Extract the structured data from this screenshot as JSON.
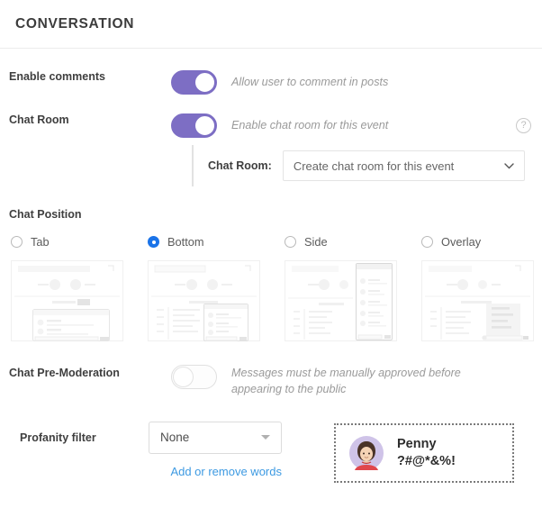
{
  "header": {
    "title": "CONVERSATION"
  },
  "enable_comments": {
    "label": "Enable comments",
    "hint": "Allow user to comment in posts",
    "toggle_state": "on"
  },
  "chat_room": {
    "label": "Chat Room",
    "hint": "Enable chat room for this event",
    "toggle_state": "on",
    "help_icon": "?",
    "sub_label": "Chat Room:",
    "select_value": "Create chat room for this event",
    "chevron": "⌄"
  },
  "chat_position": {
    "label": "Chat Position",
    "options": [
      {
        "label": "Tab",
        "selected": false
      },
      {
        "label": "Bottom",
        "selected": true
      },
      {
        "label": "Side",
        "selected": false
      },
      {
        "label": "Overlay",
        "selected": false
      }
    ]
  },
  "pre_moderation": {
    "label": "Chat Pre-Moderation",
    "hint": "Messages must be manually approved before appearing to the public",
    "toggle_state": "off"
  },
  "profanity": {
    "label": "Profanity filter",
    "select_value": "None",
    "link_label": "Add or remove words",
    "preview": {
      "name": "Penny",
      "message": "?#@*&%!",
      "avatar_bg": "#cfc3e8",
      "avatar_hair": "#4a3328",
      "avatar_shirt": "#e0474c"
    }
  },
  "colors": {
    "toggle_on": "#7d6ec4",
    "radio_selected": "#1a73e8",
    "link": "#3d9ae2"
  }
}
